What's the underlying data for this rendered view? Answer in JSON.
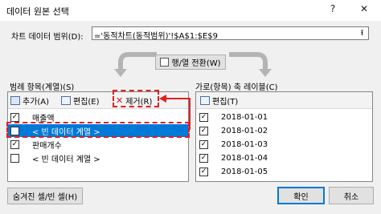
{
  "window": {
    "title": "데이터 원본 선택",
    "help_glyph": "?",
    "close_glyph": "✕"
  },
  "range": {
    "label": "차트 데이터 범위(D):",
    "value": "='동적차트(동적범위)'!$A$1:$E$9",
    "collapse_glyph": "⭱"
  },
  "switch_button": {
    "label": "행/열 전환(W)"
  },
  "series_panel": {
    "header": "범례 항목(계열)(S)",
    "add_label": "추가(A)",
    "edit_label": "편집(E)",
    "remove_label": "제거(R)",
    "items": [
      {
        "label": "매출액",
        "checked": true,
        "selected": false
      },
      {
        "label": "< 빈 데이터 계열 >",
        "checked": false,
        "selected": true
      },
      {
        "label": "판매개수",
        "checked": true,
        "selected": false
      },
      {
        "label": "< 빈 데이터 계열 >",
        "checked": false,
        "selected": false
      }
    ]
  },
  "category_panel": {
    "header": "가로(항목) 축 레이블(C)",
    "edit_label": "편집(T)",
    "items": [
      {
        "label": "2018-01-01",
        "checked": true
      },
      {
        "label": "2018-01-02",
        "checked": true
      },
      {
        "label": "2018-01-03",
        "checked": true
      },
      {
        "label": "2018-01-04",
        "checked": true
      },
      {
        "label": "2018-01-05",
        "checked": true
      }
    ]
  },
  "footer": {
    "hidden_cells_label": "숨겨진 셀/빈 셀(H)",
    "ok_label": "확인",
    "cancel_label": "취소"
  },
  "colors": {
    "selection": "#0078d7",
    "annotation": "#e02020"
  }
}
